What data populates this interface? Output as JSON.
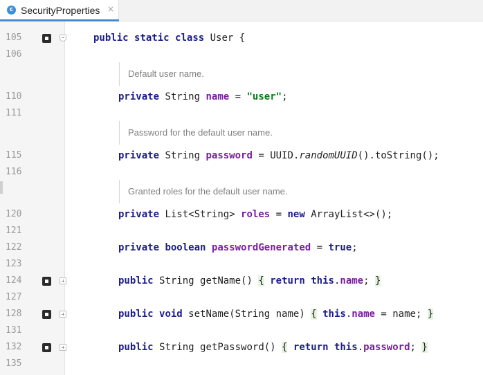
{
  "tab": {
    "title": "SecurityProperties",
    "icon": "class-icon",
    "icon_letter": "c",
    "close": "×",
    "accent": "#4a88c7"
  },
  "lines": [
    {
      "num": "105",
      "code": "public static class User {"
    },
    {
      "num": "106",
      "code": ""
    },
    {
      "num": "110",
      "code": "private String name = \"user\";"
    },
    {
      "num": "111",
      "code": ""
    },
    {
      "num": "115",
      "code": "private String password = UUID.randomUUID().toString();"
    },
    {
      "num": "116",
      "code": ""
    },
    {
      "num": "120",
      "code": "private List<String> roles = new ArrayList<>();"
    },
    {
      "num": "121",
      "code": ""
    },
    {
      "num": "122",
      "code": "private boolean passwordGenerated = true;"
    },
    {
      "num": "123",
      "code": ""
    },
    {
      "num": "124",
      "code": "public String getName() { return this.name; }"
    },
    {
      "num": "127",
      "code": ""
    },
    {
      "num": "128",
      "code": "public void setName(String name) { this.name = name; }"
    },
    {
      "num": "131",
      "code": ""
    },
    {
      "num": "132",
      "code": "public String getPassword() { return this.password; }"
    },
    {
      "num": "135",
      "code": ""
    }
  ],
  "docs": {
    "name": "Default user name.",
    "password": "Password for the default user name.",
    "roles": "Granted roles for the default user name."
  },
  "tokens": {
    "public": "public",
    "static": "static",
    "class": "class",
    "private": "private",
    "new": "new",
    "boolean": "boolean",
    "true": "true",
    "return": "return",
    "this": "this",
    "void": "void",
    "User": "User",
    "String": "String",
    "UUID": "UUID",
    "randomUUID": "randomUUID",
    "toString": "toString",
    "List": "List",
    "ArrayList": "ArrayList",
    "getName": "getName",
    "setName": "setName",
    "getPassword": "getPassword",
    "name": "name",
    "password": "password",
    "roles": "roles",
    "passwordGenerated": "passwordGenerated",
    "user_str": "\"user\""
  }
}
